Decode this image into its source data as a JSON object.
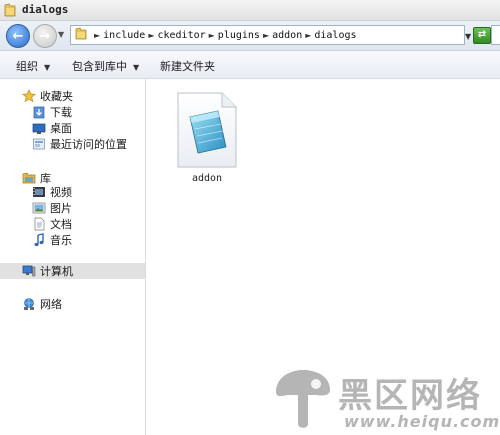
{
  "window": {
    "title": "dialogs"
  },
  "address": {
    "crumbs": [
      "include",
      "ckeditor",
      "plugins",
      "addon",
      "dialogs"
    ]
  },
  "toolbar": {
    "organize": "组织",
    "include_in_library": "包含到库中",
    "new_folder": "新建文件夹"
  },
  "sidebar": {
    "favorites": {
      "label": "收藏夹",
      "items": [
        {
          "label": "下载",
          "icon": "download-folder-icon"
        },
        {
          "label": "桌面",
          "icon": "desktop-icon"
        },
        {
          "label": "最近访问的位置",
          "icon": "recent-places-icon"
        }
      ]
    },
    "libraries": {
      "label": "库",
      "items": [
        {
          "label": "视频",
          "icon": "video-icon"
        },
        {
          "label": "图片",
          "icon": "pictures-icon"
        },
        {
          "label": "文档",
          "icon": "documents-icon"
        },
        {
          "label": "音乐",
          "icon": "music-icon"
        }
      ]
    },
    "computer": {
      "label": "计算机",
      "selected": true
    },
    "network": {
      "label": "网络"
    }
  },
  "files": [
    {
      "name": "addon",
      "icon": "notepad-file-icon"
    }
  ],
  "watermark": {
    "text": "黑区网络",
    "url": "www.heiqu.com"
  },
  "colors": {
    "back_button": "#2a6bc9",
    "refresh_button": "#2f8a1f",
    "selection": "#e1e1e1"
  }
}
